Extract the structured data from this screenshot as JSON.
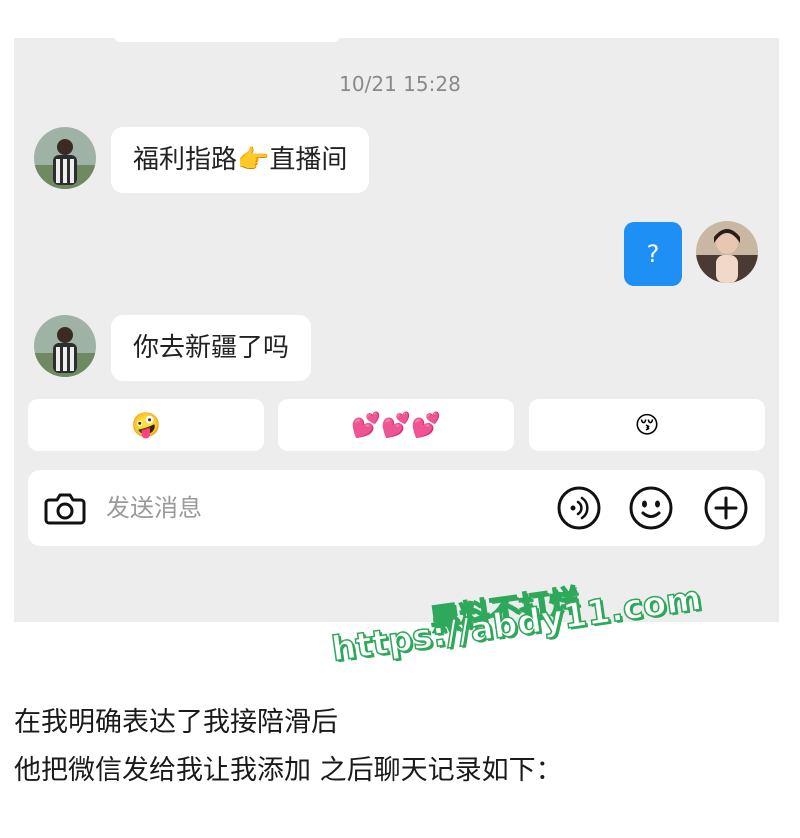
{
  "chat": {
    "timestamp": "10/21 15:28",
    "messages": [
      {
        "side": "left",
        "text": "福利指路👉直播间"
      },
      {
        "side": "right",
        "text": "?"
      },
      {
        "side": "left",
        "text": "你去新疆了吗"
      }
    ]
  },
  "quick_replies": [
    "🤪",
    "💕💕💕",
    "😚"
  ],
  "composer": {
    "placeholder": "发送消息",
    "icons": [
      "camera-icon",
      "voice-icon",
      "emoji-icon",
      "plus-icon"
    ]
  },
  "caption": {
    "line1": "在我明确表达了我接陪滑后",
    "line2": "他把微信发给我让我添加 之后聊天记录如下："
  },
  "watermark": {
    "line1": "黑料不打烊",
    "line2": "https://abdy11.com"
  },
  "colors": {
    "panel_bg": "#ededed",
    "bubble_bg": "#ffffff",
    "sent_bubble": "#1d8ff5",
    "watermark_green": "#2ea85a"
  }
}
